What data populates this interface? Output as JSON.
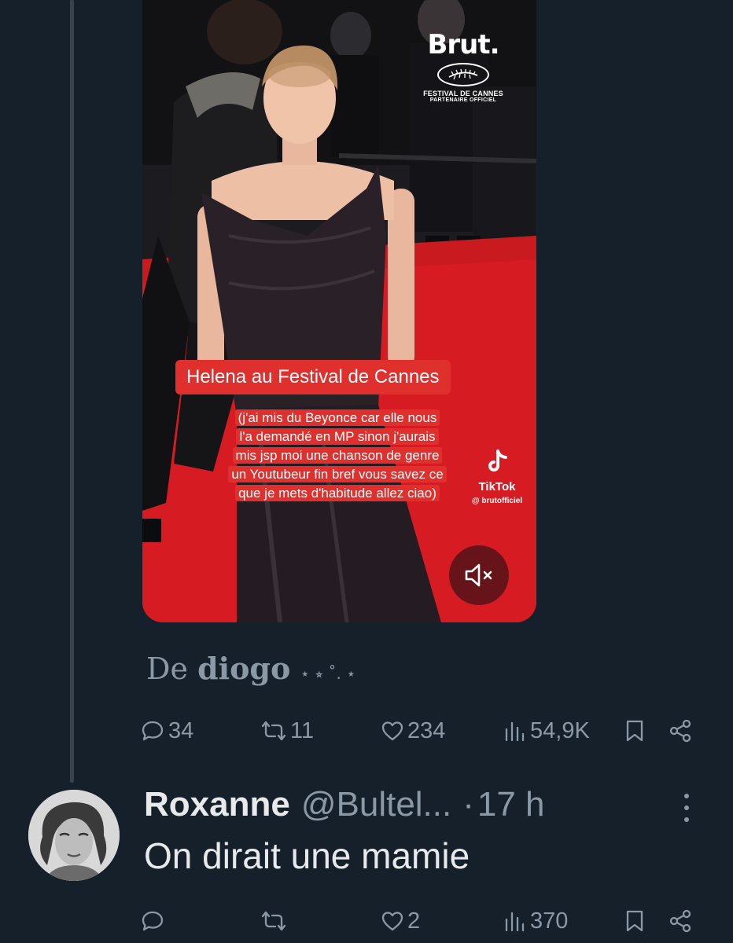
{
  "video": {
    "brand_name": "Brut.",
    "brand_subtitle_1": "FESTIVAL DE CANNES",
    "brand_subtitle_2": "PARTENAIRE OFFICIEL",
    "caption_title": "Helena au Festival de Cannes",
    "caption_lines": [
      "(j'ai mis du Beyonce car elle nous",
      "l'a demandé en MP sinon j'aurais",
      "mis jsp moi une chanson de genre",
      "un Youtubeur fin bref vous savez ce",
      "que je mets d'habitude allez ciao)"
    ],
    "tiktok_label": "TikTok",
    "tiktok_handle": "@ brutofficiel"
  },
  "tweet": {
    "source_prefix": "De",
    "source_name": "diogo",
    "source_stars": "⋆ ⭒ ˚. ⋆",
    "actions": {
      "replies": "34",
      "retweets": "11",
      "likes": "234",
      "views": "54,9K"
    }
  },
  "reply": {
    "name": "Roxanne",
    "handle": "@Bultel...",
    "dot": "·",
    "time": "17 h",
    "text": "On dirait une mamie",
    "actions": {
      "replies": "",
      "retweets": "",
      "likes": "2",
      "views": "370"
    }
  },
  "colors": {
    "background": "#15202b",
    "muted_text": "#8b98a5",
    "primary_text": "#e7e9ea",
    "caption_red": "#e0302e",
    "carpet_red": "#d61c22"
  }
}
